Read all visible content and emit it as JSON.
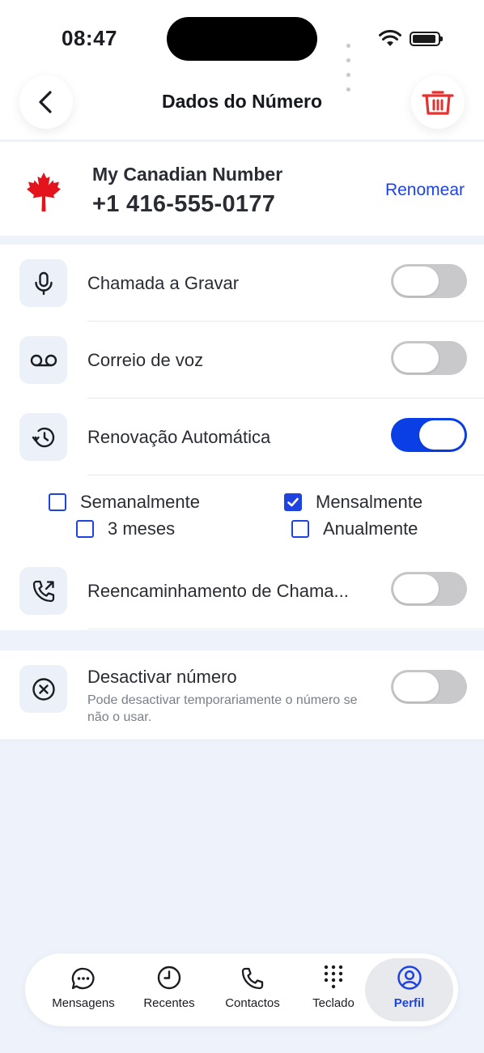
{
  "status_bar": {
    "time": "08:47"
  },
  "header": {
    "title": "Dados do Número"
  },
  "number": {
    "label": "My Canadian Number",
    "value": "+1 416-555-0177",
    "rename_label": "Renomear"
  },
  "settings": {
    "record_calls": {
      "label": "Chamada a Gravar",
      "enabled": false
    },
    "voicemail": {
      "label": "Correio de voz",
      "enabled": false
    },
    "auto_renew": {
      "label": "Renovação Automática",
      "enabled": true
    },
    "renew_options": [
      {
        "label": "Semanalmente",
        "checked": false
      },
      {
        "label": "Mensalmente",
        "checked": true
      },
      {
        "label": "3 meses",
        "checked": false
      },
      {
        "label": "Anualmente",
        "checked": false
      }
    ],
    "call_forwarding": {
      "label": "Reencaminhamento de Chama...",
      "enabled": false
    }
  },
  "deactivate": {
    "label": "Desactivar número",
    "description": "Pode desactivar temporariamente o número se não o usar.",
    "enabled": false
  },
  "tabs": [
    {
      "label": "Mensagens",
      "icon": "chat-icon"
    },
    {
      "label": "Recentes",
      "icon": "clock-icon"
    },
    {
      "label": "Contactos",
      "icon": "phone-icon"
    },
    {
      "label": "Teclado",
      "icon": "keypad-icon"
    },
    {
      "label": "Perfil",
      "icon": "profile-icon",
      "active": true
    }
  ],
  "colors": {
    "accent": "#1e43e0",
    "toggle_on": "#0a3fe6",
    "delete": "#e5312f",
    "flag": "#e3141b"
  }
}
